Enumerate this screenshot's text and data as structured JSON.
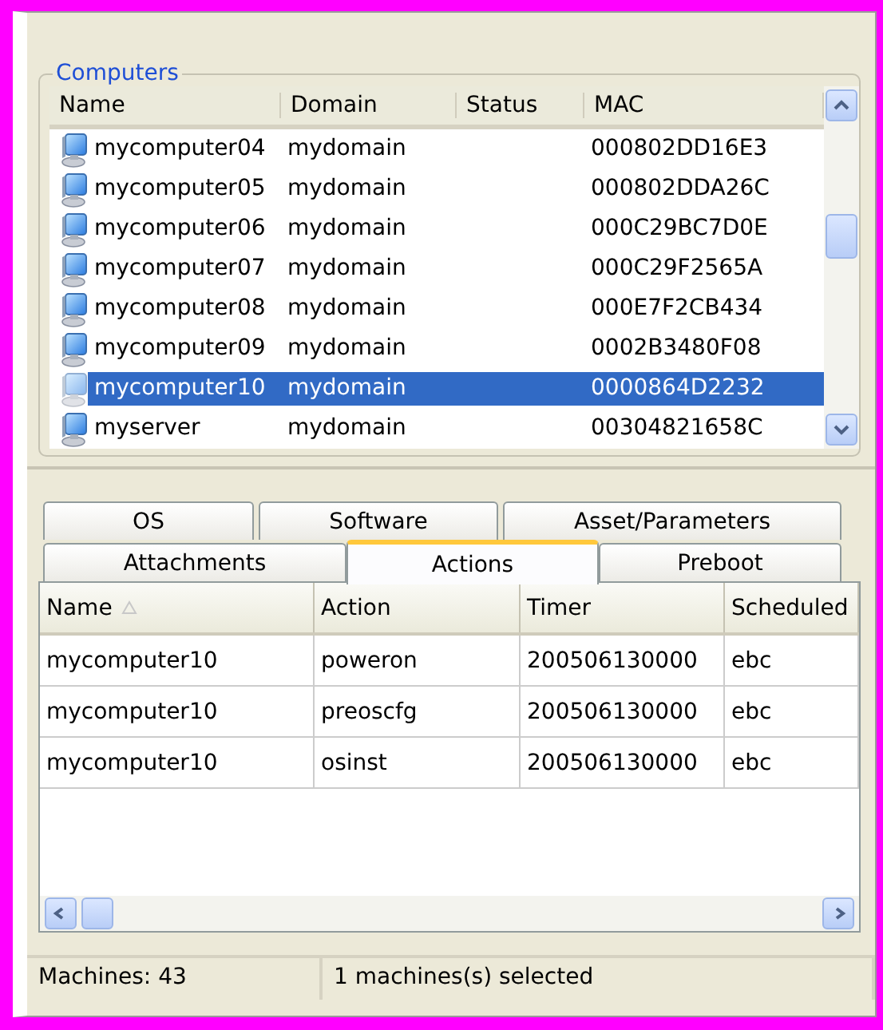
{
  "computers": {
    "title": "Computers",
    "columns": [
      "Name",
      "Domain",
      "Status",
      "MAC"
    ],
    "rows": [
      {
        "name": "mycomputer04",
        "domain": "mydomain",
        "mac": "000802DD16E3",
        "selected": false
      },
      {
        "name": "mycomputer05",
        "domain": "mydomain",
        "mac": "000802DDA26C",
        "selected": false
      },
      {
        "name": "mycomputer06",
        "domain": "mydomain",
        "mac": "000C29BC7D0E",
        "selected": false
      },
      {
        "name": "mycomputer07",
        "domain": "mydomain",
        "mac": "000C29F2565A",
        "selected": false
      },
      {
        "name": "mycomputer08",
        "domain": "mydomain",
        "mac": "000E7F2CB434",
        "selected": false
      },
      {
        "name": "mycomputer09",
        "domain": "mydomain",
        "mac": "0002B3480F08",
        "selected": false
      },
      {
        "name": "mycomputer10",
        "domain": "mydomain",
        "mac": "0000864D2232",
        "selected": true
      },
      {
        "name": "myserver",
        "domain": "mydomain",
        "mac": "00304821658C",
        "selected": false
      }
    ]
  },
  "tab_rows": [
    {
      "tabs": [
        {
          "label": "OS",
          "selected": false
        },
        {
          "label": "Software",
          "selected": false
        },
        {
          "label": "Asset/Parameters",
          "selected": false
        }
      ]
    },
    {
      "tabs": [
        {
          "label": "Attachments",
          "selected": false
        },
        {
          "label": "Actions",
          "selected": true
        },
        {
          "label": "Preboot",
          "selected": false
        }
      ]
    }
  ],
  "actions_table": {
    "columns": [
      {
        "label": "Name",
        "sorted": true
      },
      {
        "label": "Action",
        "sorted": false
      },
      {
        "label": "Timer",
        "sorted": false
      },
      {
        "label": "Scheduled",
        "sorted": false
      }
    ],
    "rows": [
      {
        "cells": [
          "mycomputer10",
          "poweron",
          "200506130000",
          "ebc"
        ]
      },
      {
        "cells": [
          "mycomputer10",
          "preoscfg",
          "200506130000",
          "ebc"
        ]
      },
      {
        "cells": [
          "mycomputer10",
          "osinst",
          "200506130000",
          "ebc"
        ]
      }
    ]
  },
  "status_bar": [
    "Machines: 43",
    "1 machines(s) selected"
  ]
}
